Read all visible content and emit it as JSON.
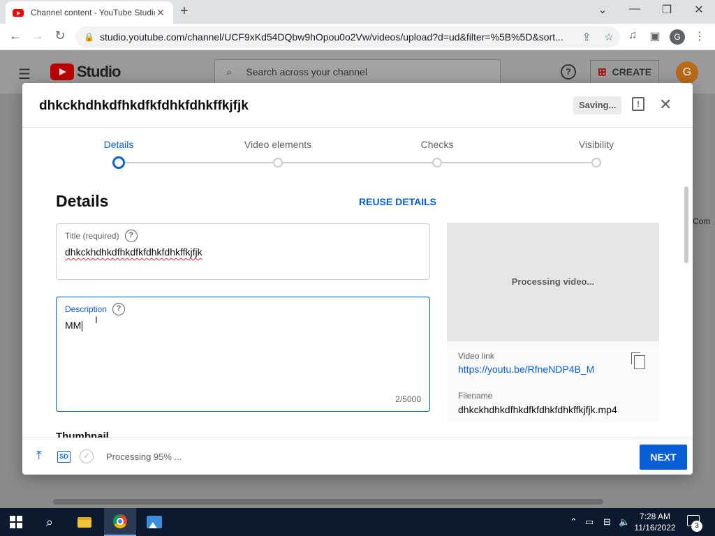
{
  "browser": {
    "tab_title": "Channel content - YouTube Studio",
    "tab_close": "✕",
    "new_tab": "+",
    "url": "studio.youtube.com/channel/UCF9xKd54DQbw9hOpou0o2Vw/videos/upload?d=ud&filter=%5B%5D&sort...",
    "profile_initial": "G"
  },
  "studio": {
    "logo_text": "Studio",
    "search_placeholder": "Search across your channel",
    "create_label": "CREATE",
    "avatar_initial": "G",
    "side_text": "Com"
  },
  "modal": {
    "title": "dhkckhdhkdfhkdfkfdhkfdhkffkjfjk",
    "saving_label": "Saving...",
    "steps": [
      {
        "label": "Details",
        "active": true
      },
      {
        "label": "Video elements",
        "active": false
      },
      {
        "label": "Checks",
        "active": false
      },
      {
        "label": "Visibility",
        "active": false
      }
    ],
    "section_title": "Details",
    "reuse_label": "REUSE DETAILS",
    "title_field": {
      "label": "Title (required)",
      "value": "dhkckhdhkdfhkdfkfdhkfdhkffkjfjk"
    },
    "description_field": {
      "label": "Description",
      "value": "MM",
      "counter": "2/5000"
    },
    "thumbnail_heading": "Thumbnail",
    "preview_text": "Processing video...",
    "video_link_label": "Video link",
    "video_link": "https://youtu.be/RfneNDP4B_M",
    "filename_label": "Filename",
    "filename": "dhkckhdhkdfhkdfkfdhkfdhkffkjfjk.mp4",
    "footer": {
      "sd_badge": "SD",
      "processing": "Processing 95% ...",
      "next_label": "NEXT"
    }
  },
  "taskbar": {
    "time": "7:28 AM",
    "date": "11/16/2022",
    "notifications": "3"
  },
  "colors": {
    "accent": "#065fd4",
    "youtube_red": "#ff0000",
    "taskbar": "#0c1a2e"
  }
}
